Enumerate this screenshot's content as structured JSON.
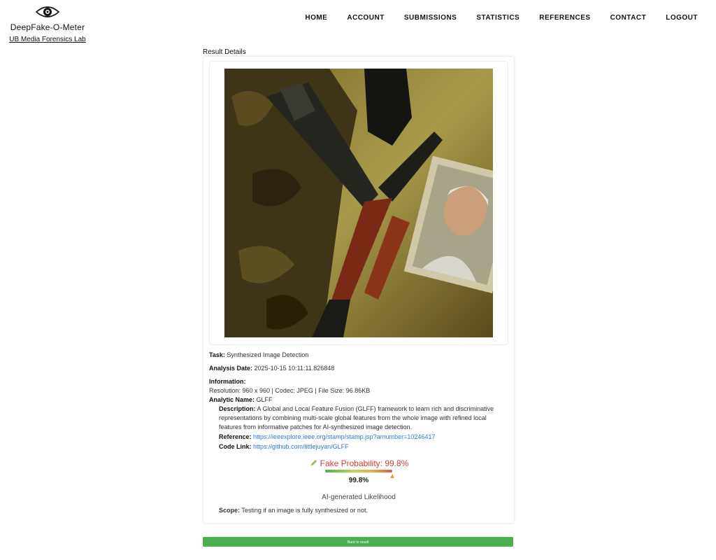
{
  "brand": {
    "name": "DeepFake-O-Meter",
    "lab": "UB Media Forensics Lab",
    "logo_icon": "eye-logo-icon"
  },
  "nav": [
    "HOME",
    "ACCOUNT",
    "SUBMISSIONS",
    "STATISTICS",
    "REFERENCES",
    "CONTACT",
    "LOGOUT"
  ],
  "section_title": "Result Details",
  "details": {
    "task_label": "Task:",
    "task_value": "Synthesized Image Detection",
    "date_label": "Analysis Date:",
    "date_value": "2025-10-15 10:11:11.826848",
    "info_label": "Information:",
    "info_value": "Resolution: 960 x 960 | Codec: JPEG | File Size: 96.86KB",
    "analytic_label": "Analytic Name:",
    "analytic_value": "GLFF",
    "desc_label": "Description:",
    "desc_value": "A Global and Local Feature Fusion (GLFF) framework to learn rich and discriminative representations by combining multi-scale global features from the whole image with refined local features from informative patches for AI-synthesized image detection.",
    "ref_label": "Reference:",
    "ref_value": "https://ieeexplore.ieee.org/stamp/stamp.jsp?arnumber=10246417",
    "code_label": "Code Link:",
    "code_value": "https://github.com/littlejuyan/GLFF"
  },
  "result": {
    "fake_label": "Fake Probability: 99.8%",
    "probability": 0.998,
    "percent_text": "99.8%",
    "likelihood_label": "AI-generated Likelihood",
    "scope_label": "Scope:",
    "scope_value": "Testing if an image is fully synthesized or not.",
    "accent_color": "#d23b3b"
  },
  "back_button": "Back to result"
}
